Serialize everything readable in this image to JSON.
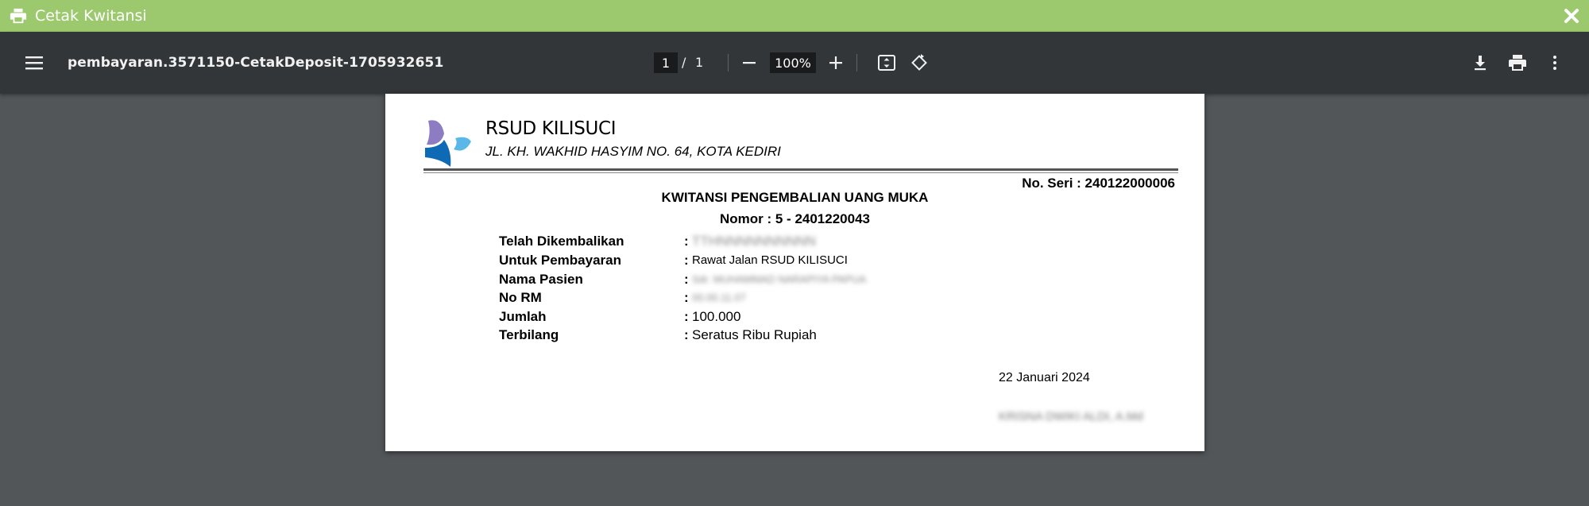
{
  "window": {
    "title": "Cetak Kwitansi",
    "icons": {
      "print": "print-icon",
      "close": "close-icon"
    },
    "accent_color": "#9cc96e"
  },
  "viewer": {
    "filename": "pembayaran.3571150-CetakDeposit-1705932651",
    "current_page": "1",
    "page_separator": "/",
    "total_pages": "1",
    "zoom": "100%",
    "toolbar_color": "#323639",
    "icons": [
      "menu-icon",
      "zoom-out-icon",
      "zoom-in-icon",
      "fit-page-icon",
      "rotate-icon",
      "download-icon",
      "print-icon",
      "more-vert-icon"
    ]
  },
  "document": {
    "hospital_name": "RSUD KILISUCI",
    "hospital_address": "JL. KH. WAKHID HASYIM NO. 64, KOTA KEDIRI",
    "serial": "No. Seri : 240122000006",
    "title": "KWITANSI PENGEMBALIAN UANG MUKA",
    "number": "Nomor  :  5 - 2401220043",
    "rows": [
      {
        "label": "Telah Dikembalikan",
        "value": "TTHNNNNNNNNNN"
      },
      {
        "label": "Untuk Pembayaran",
        "value": "Rawat Jalan RSUD KILISUCI"
      },
      {
        "label": "Nama Pasien",
        "value": "Sdr. MUHAMMAD NARAPIYA PAPUA"
      },
      {
        "label": "No RM",
        "value": "00.00.11.07"
      },
      {
        "label": "Jumlah",
        "value": "100.000"
      },
      {
        "label": "Terbilang",
        "value": "Seratus Ribu Rupiah"
      }
    ],
    "colon": ":",
    "date": "22 Januari 2024",
    "signer": "KRISNA DWIKI ALDI, A.Md"
  }
}
